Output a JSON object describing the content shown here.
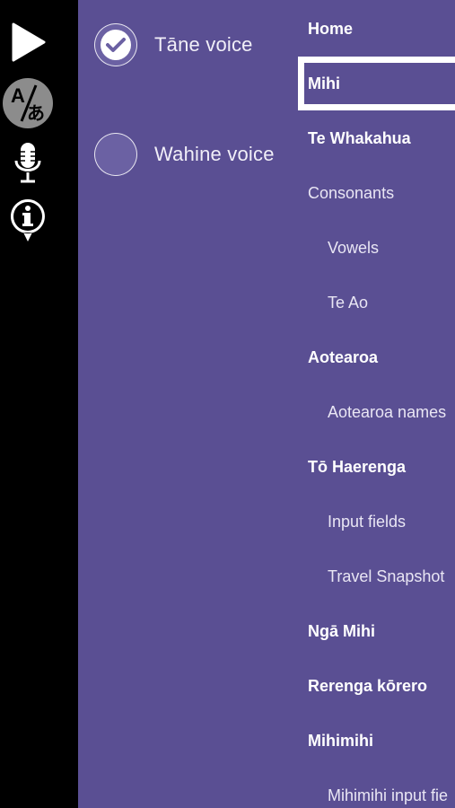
{
  "toolbar": {
    "icons": [
      "play-icon",
      "translate-icon",
      "microphone-icon",
      "info-icon"
    ],
    "translate_glyph_top": "A",
    "translate_glyph_bottom": "あ"
  },
  "voices": [
    {
      "label": "Tāne voice",
      "selected": true
    },
    {
      "label": "Wahine voice",
      "selected": false
    }
  ],
  "menu": {
    "items": [
      {
        "label": "Home",
        "style": "bold"
      },
      {
        "label": "Mihi",
        "style": "bold",
        "selected": true
      },
      {
        "label": "Te Whakahua",
        "style": "bold"
      },
      {
        "label": "Consonants",
        "style": "plain"
      },
      {
        "label": "Vowels",
        "style": "sub"
      },
      {
        "label": "Te Ao",
        "style": "sub"
      },
      {
        "label": "Aotearoa",
        "style": "bold"
      },
      {
        "label": "Aotearoa names",
        "style": "sub"
      },
      {
        "label": "Tō Haerenga",
        "style": "bold"
      },
      {
        "label": "Input fields",
        "style": "sub"
      },
      {
        "label": "Travel Snapshot",
        "style": "sub"
      },
      {
        "label": "Ngā Mihi",
        "style": "bold"
      },
      {
        "label": "Rerenga kōrero",
        "style": "bold"
      },
      {
        "label": "Mihimihi",
        "style": "bold"
      },
      {
        "label": "Mihimihi input fie",
        "style": "sub"
      }
    ]
  },
  "colors": {
    "panel": "#5a4f93",
    "toolbar": "#000000",
    "accent": "#ffffff"
  }
}
